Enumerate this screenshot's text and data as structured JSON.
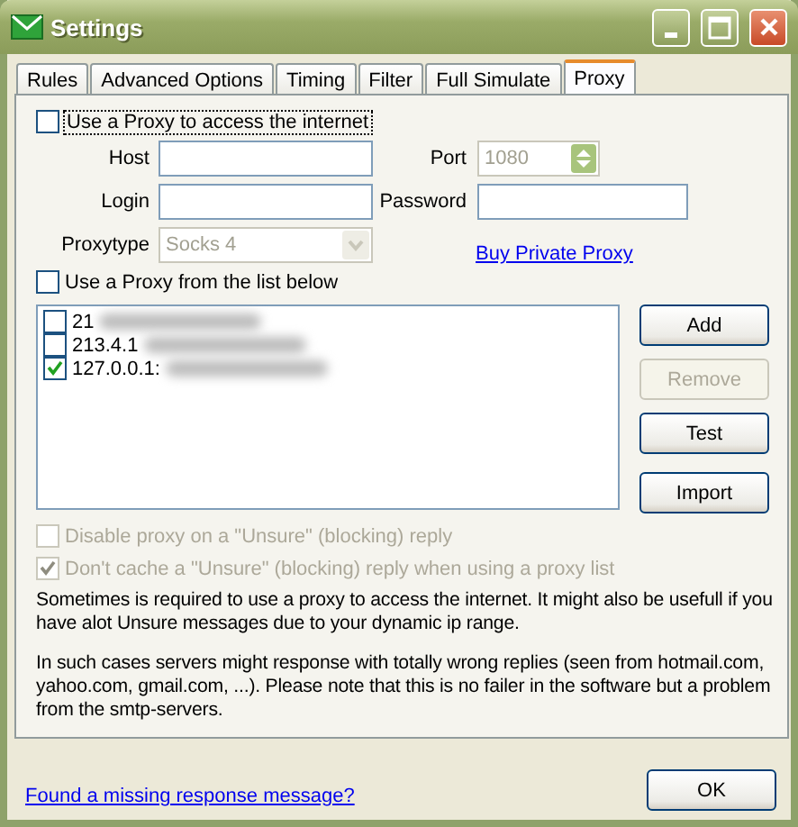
{
  "window": {
    "title": "Settings"
  },
  "tabs": [
    {
      "label": "Rules",
      "selected": false
    },
    {
      "label": "Advanced Options",
      "selected": false
    },
    {
      "label": "Timing",
      "selected": false
    },
    {
      "label": "Filter",
      "selected": false
    },
    {
      "label": "Full Simulate",
      "selected": false
    },
    {
      "label": "Proxy",
      "selected": true
    }
  ],
  "use_proxy": {
    "label": "Use a Proxy to access the internet",
    "checked": false
  },
  "host": {
    "label": "Host"
  },
  "port": {
    "label": "Port",
    "value": "1080",
    "disabled": true
  },
  "login": {
    "label": "Login"
  },
  "password": {
    "label": "Password"
  },
  "proxytype": {
    "label": "Proxytype",
    "value": "Socks 4",
    "disabled": true
  },
  "buy_link": "Buy Private Proxy",
  "use_list": {
    "label": "Use a Proxy from the list below",
    "checked": false
  },
  "proxy_list": [
    {
      "text": "21",
      "checked": false
    },
    {
      "text": "213.4.1",
      "checked": false
    },
    {
      "text": "127.0.0.1:",
      "checked": true
    }
  ],
  "list_buttons": [
    {
      "label": "Add",
      "disabled": false
    },
    {
      "label": "Remove",
      "disabled": true
    },
    {
      "label": "Test",
      "disabled": false
    },
    {
      "label": "Import",
      "disabled": false
    }
  ],
  "options": [
    {
      "label": "Disable proxy on a \"Unsure\" (blocking) reply",
      "checked": false,
      "disabled": true
    },
    {
      "label": "Don't cache a \"Unsure\" (blocking) reply when using a proxy list",
      "checked": true,
      "disabled": true
    }
  ],
  "info": [
    "Sometimes is required to use a proxy to access the internet. It might also be usefull if you have alot Unsure messages due to your dynamic ip range.",
    "In such cases servers might response with totally wrong replies (seen from hotmail.com, yahoo.com, gmail.com, ...). Please note that this is no failer in the software but a problem from the smtp-servers."
  ],
  "footer": {
    "link": "Found a missing response message?",
    "ok": "OK"
  }
}
